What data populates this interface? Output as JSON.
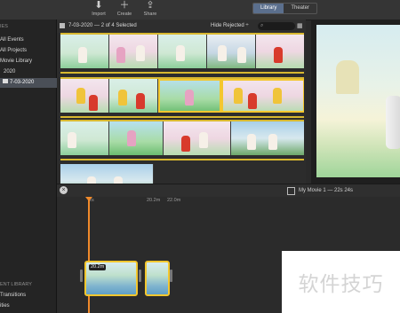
{
  "toolbar": {
    "import_label": "Import",
    "create_label": "Create",
    "share_label": "Share",
    "tabs": [
      "Library",
      "Theater"
    ]
  },
  "sidebar": {
    "items": [
      {
        "label": "IES"
      },
      {
        "label": "All Events"
      },
      {
        "label": "All Projects"
      },
      {
        "label": "Movie Library"
      },
      {
        "label": "2020"
      },
      {
        "label": "7-03-2020"
      }
    ],
    "bottom_header": "ENT LIBRARY",
    "bottom_items": [
      "Transitions",
      "ities"
    ]
  },
  "browser": {
    "date_status": "7-03-2020 — 2 of 4 Selected",
    "filter_label": "Hide Rejected ÷"
  },
  "timeline": {
    "project_title": "My Movie 1 — 22s 24s",
    "ruler_labels": [
      "2s",
      "20.2m",
      "22.0m"
    ],
    "clip_duration": "20.2m"
  },
  "watermark": {
    "text": "软件技巧"
  },
  "colors": {
    "selection": "#f3c72f",
    "playhead": "#f08a2b",
    "sidebar_selected": "#4a4f57"
  }
}
